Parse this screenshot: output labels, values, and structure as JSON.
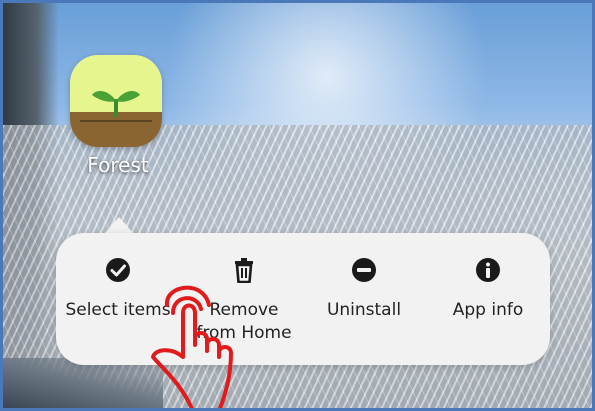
{
  "app": {
    "name": "Forest",
    "icon": "forest-sprout-icon"
  },
  "context_menu": {
    "items": [
      {
        "label": "Select items",
        "icon": "check-circle-icon"
      },
      {
        "label": "Remove\nfrom Home",
        "icon": "trash-icon"
      },
      {
        "label": "Uninstall",
        "icon": "minus-circle-icon"
      },
      {
        "label": "App info",
        "icon": "info-circle-icon"
      }
    ]
  },
  "annotation": {
    "icon": "tap-hand-icon",
    "color": "#e11b1b"
  },
  "colors": {
    "menu_bg": "#f2f2f2",
    "frame_border": "#4a78b8",
    "icon_dark": "#1a1a1a"
  }
}
